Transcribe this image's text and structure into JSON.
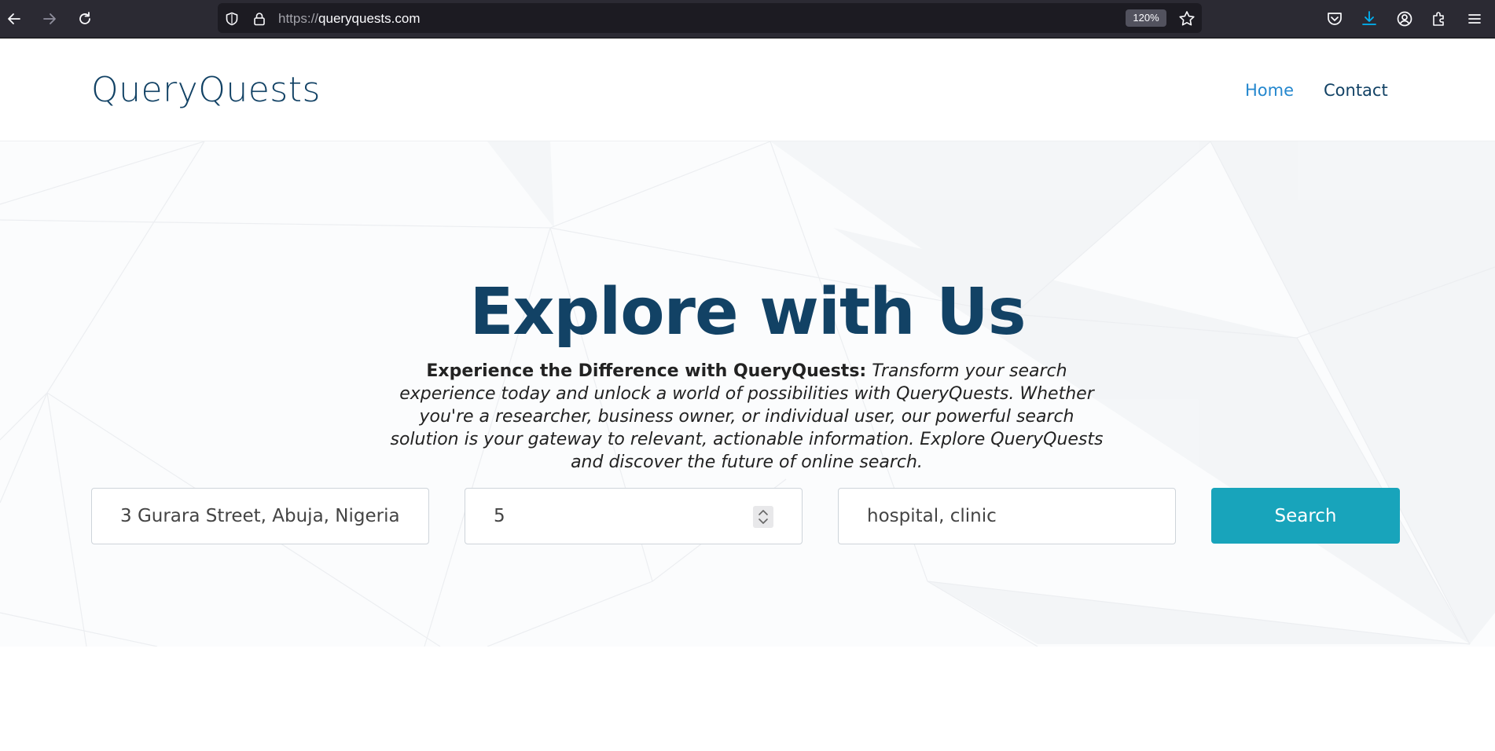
{
  "browser": {
    "url_scheme": "https://",
    "url_host": "queryquests.com",
    "zoom": "120%",
    "icons": [
      "back-icon",
      "forward-icon",
      "reload-icon",
      "shield-icon",
      "lock-icon",
      "star-icon",
      "pocket-icon",
      "download-icon",
      "account-icon",
      "extensions-icon",
      "menu-icon"
    ],
    "colors": {
      "chrome_bg": "#2b2a33",
      "urlbar_bg": "#1c1b22",
      "download_accent": "#00b3f4"
    }
  },
  "header": {
    "logo": "QueryQuests",
    "nav": [
      {
        "label": "Home",
        "active": true
      },
      {
        "label": "Contact",
        "active": false
      }
    ]
  },
  "hero": {
    "title": "Explore with Us",
    "lead": "Experience the Difference with QueryQuests:",
    "body": " Transform your search experience today and unlock a world of possibilities with QueryQuests. Whether you're a researcher, business owner, or individual user, our powerful search solution is your gateway to relevant, actionable information. Explore QueryQuests and discover the future of online search."
  },
  "search_form": {
    "address_value": "3 Gurara Street, Abuja, Nigeria",
    "radius_value": "5",
    "types_value": "hospital, clinic",
    "button_label": "Search"
  },
  "colors": {
    "brand": "#124265",
    "nav_active": "#2487ce",
    "button": "#18a4bb"
  }
}
